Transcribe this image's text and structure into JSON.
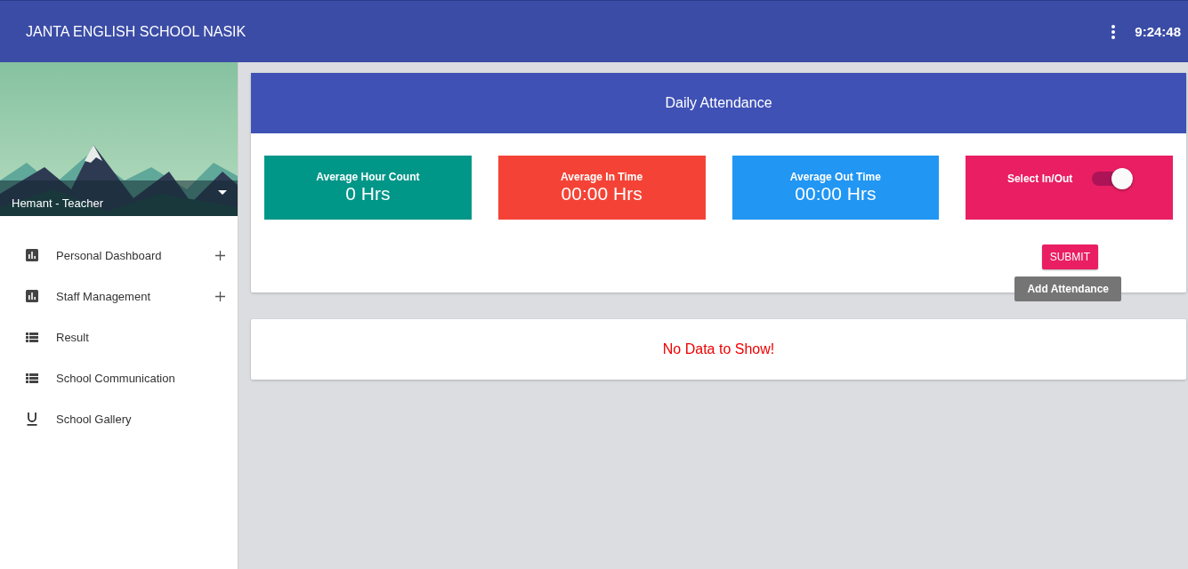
{
  "header": {
    "title": "JANTA ENGLISH SCHOOL NASIK",
    "time": "9:24:48"
  },
  "profile": {
    "name": "Hemant - Teacher"
  },
  "nav": [
    {
      "label": "Personal Dashboard",
      "kind": "chart",
      "expandable": true
    },
    {
      "label": "Staff Management",
      "kind": "chart",
      "expandable": true
    },
    {
      "label": "Result",
      "kind": "list",
      "expandable": false
    },
    {
      "label": "School Communication",
      "kind": "list",
      "expandable": false
    },
    {
      "label": "School Gallery",
      "kind": "underline",
      "expandable": false
    }
  ],
  "attendance": {
    "title": "Daily Attendance",
    "tiles": [
      {
        "kind": "stat",
        "label": "Average Hour Count",
        "value": "0 Hrs",
        "color": "#009688"
      },
      {
        "kind": "stat",
        "label": "Average In Time",
        "value": "00:00 Hrs",
        "color": "#f44336"
      },
      {
        "kind": "stat",
        "label": "Average Out Time",
        "value": "00:00 Hrs",
        "color": "#2196f3"
      },
      {
        "kind": "toggle",
        "label": "Select In/Out",
        "on": true,
        "color": "#e91e63"
      }
    ],
    "submit": "SUBMIT",
    "tooltip": "Add Attendance"
  },
  "empty": {
    "message": "No Data to Show!"
  }
}
